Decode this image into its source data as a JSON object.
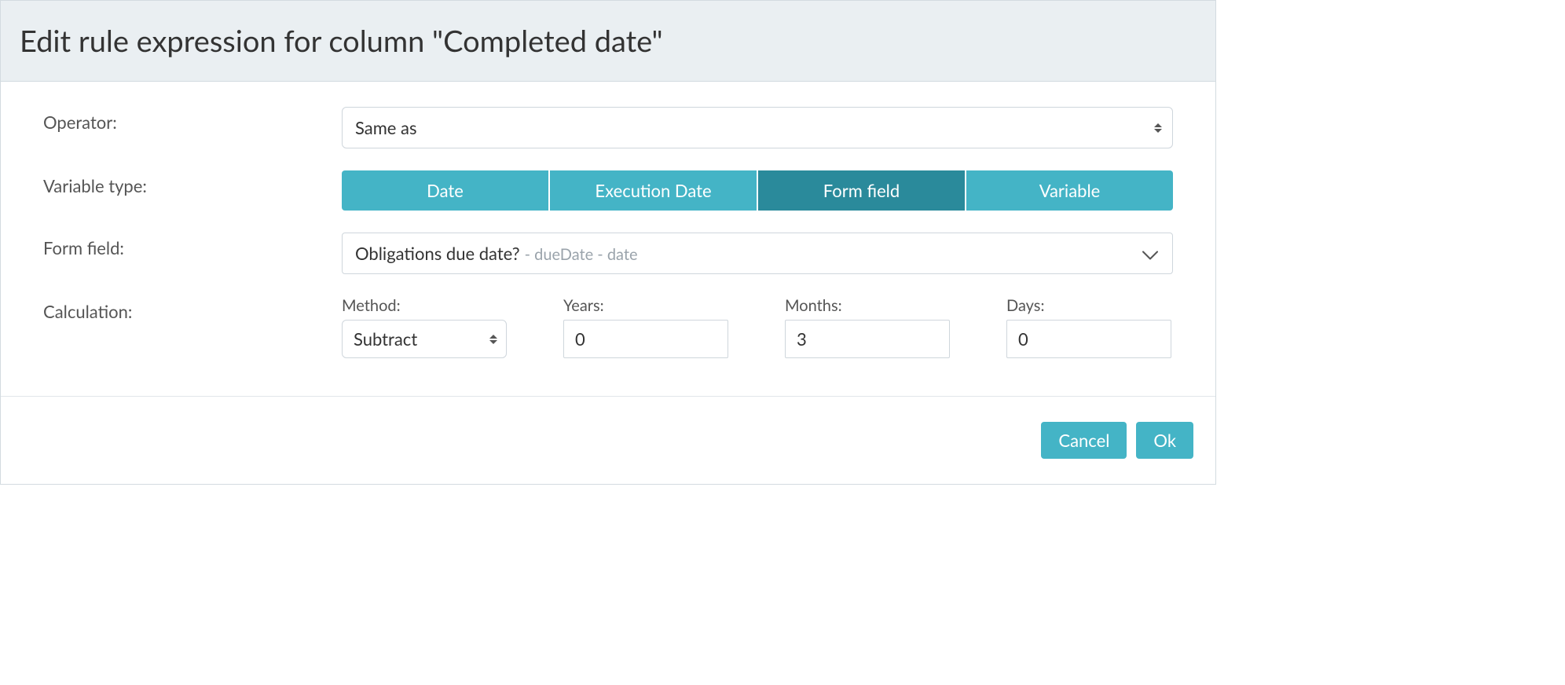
{
  "dialog": {
    "title": "Edit rule expression for column \"Completed date\""
  },
  "form": {
    "operator_label": "Operator:",
    "operator_value": "Same as",
    "variable_type_label": "Variable type:",
    "variable_types": {
      "date": "Date",
      "execution_date": "Execution Date",
      "form_field": "Form field",
      "variable": "Variable"
    },
    "form_field_label": "Form field:",
    "form_field_value": "Obligations due date?",
    "form_field_meta": "- dueDate - date",
    "calculation_label": "Calculation:",
    "calc": {
      "method_label": "Method:",
      "method_value": "Subtract",
      "years_label": "Years:",
      "years_value": "0",
      "months_label": "Months:",
      "months_value": "3",
      "days_label": "Days:",
      "days_value": "0"
    }
  },
  "footer": {
    "cancel": "Cancel",
    "ok": "Ok"
  }
}
